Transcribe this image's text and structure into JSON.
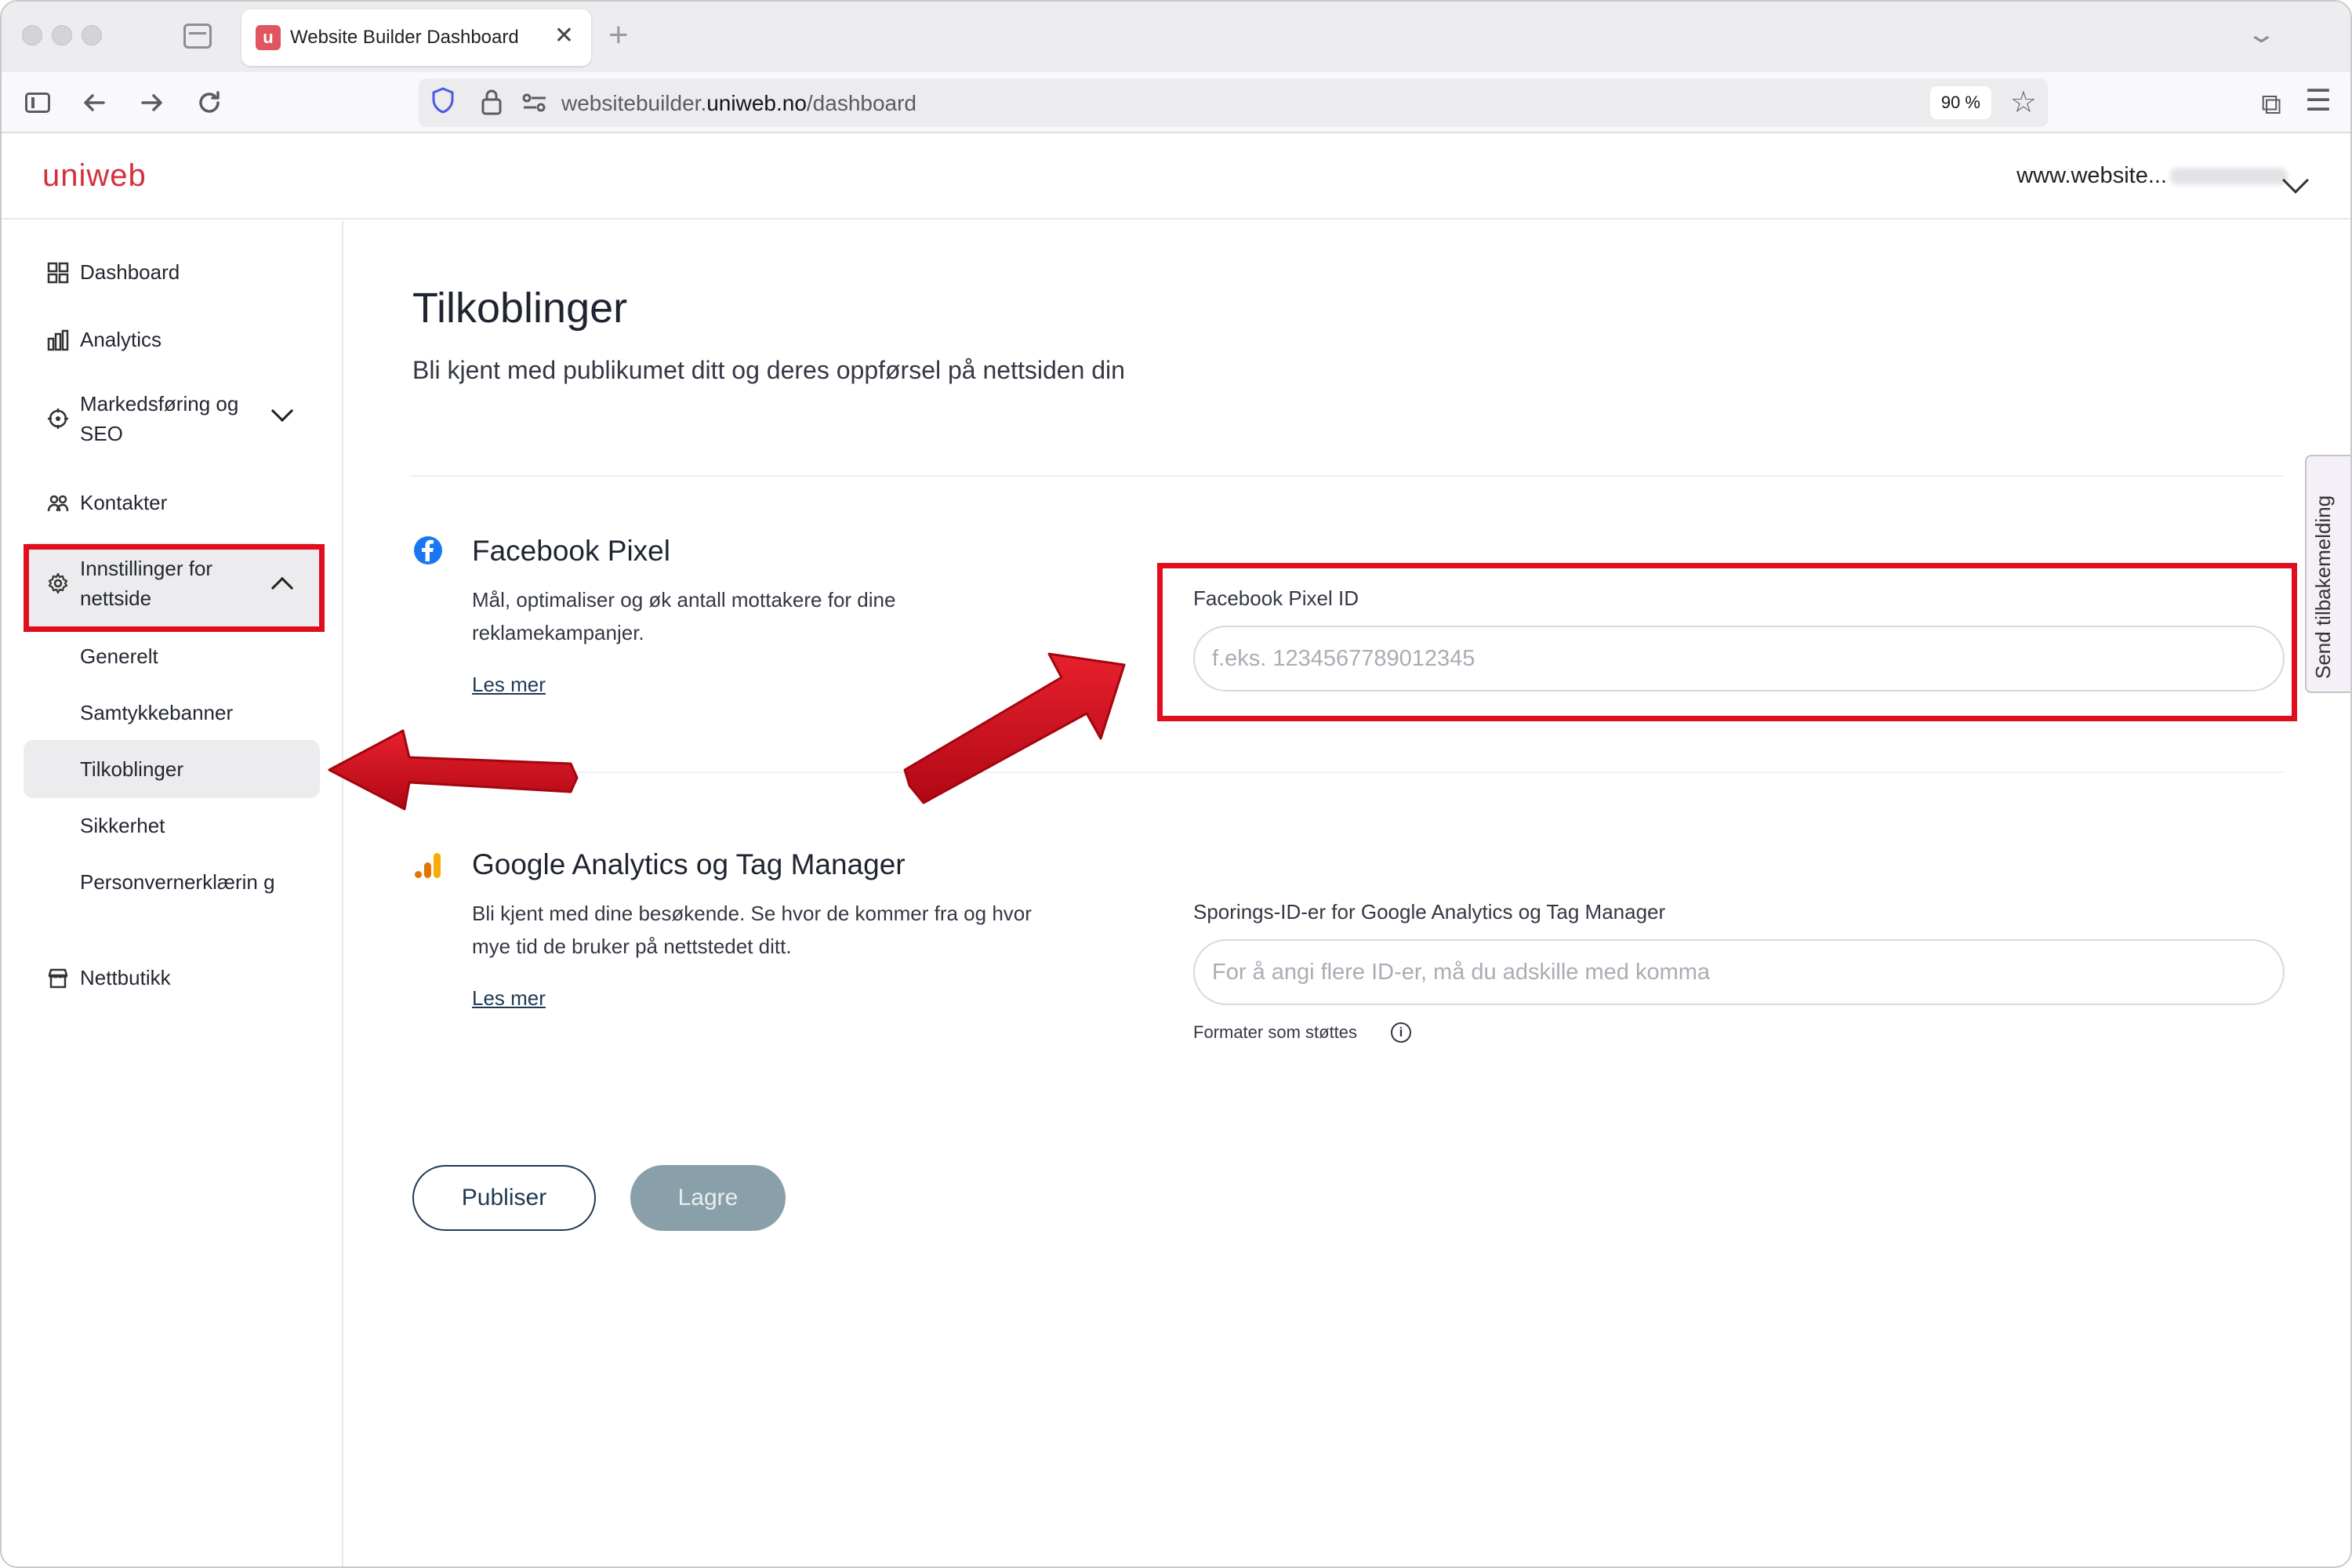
{
  "browser": {
    "tab_title": "Website Builder Dashboard",
    "tab_favicon_letter": "u",
    "close_glyph": "✕",
    "new_tab_glyph": "+",
    "url_prefix": "websitebuilder.",
    "url_domain": "uniweb.no",
    "url_path": "/dashboard",
    "zoom": "90 %"
  },
  "header": {
    "logo": "uniweb",
    "site_name": "www.website..."
  },
  "sidebar": {
    "items": [
      {
        "label": "Dashboard",
        "icon": "dashboard-grid-icon"
      },
      {
        "label": "Analytics",
        "icon": "bar-chart-icon"
      },
      {
        "label": "Markedsføring og SEO",
        "icon": "target-icon"
      },
      {
        "label": "Kontakter",
        "icon": "people-icon"
      },
      {
        "label": "Innstillinger for nettside",
        "icon": "gear-icon"
      },
      {
        "label": "Nettbutikk",
        "icon": "store-icon"
      }
    ],
    "sub_items": [
      "Generelt",
      "Samtykkebanner",
      "Tilkoblinger",
      "Sikkerhet",
      "Personvernerklærin g"
    ],
    "active_sub": "Tilkoblinger"
  },
  "main": {
    "title": "Tilkoblinger",
    "subtitle": "Bli kjent med publikumet ditt og deres oppførsel på nettsiden din",
    "facebook": {
      "title": "Facebook Pixel",
      "description": "Mål, optimaliser og øk antall mottakere for dine reklamekampanjer.",
      "learn_more": "Les mer",
      "field_label": "Facebook Pixel ID",
      "placeholder": "f.eks. 1234567789012345",
      "value": ""
    },
    "google": {
      "title": "Google Analytics og Tag Manager",
      "description": "Bli kjent med dine besøkende. Se hvor de kommer fra og hvor mye tid de bruker på nettstedet ditt.",
      "learn_more": "Les mer",
      "field_label": "Sporings-ID-er for Google Analytics og Tag Manager",
      "placeholder": "For å angi flere ID-er, må du adskille med komma",
      "value": "",
      "formats": "Formater som støttes",
      "info_glyph": "i"
    },
    "publish_label": "Publiser",
    "save_label": "Lagre"
  },
  "feedback": {
    "label": "Send tilbakemelding"
  },
  "colors": {
    "brand": "#d5303c",
    "annotation": "#e10f1e",
    "primary_text": "#1f3a55",
    "save_button": "#89a0ab"
  }
}
